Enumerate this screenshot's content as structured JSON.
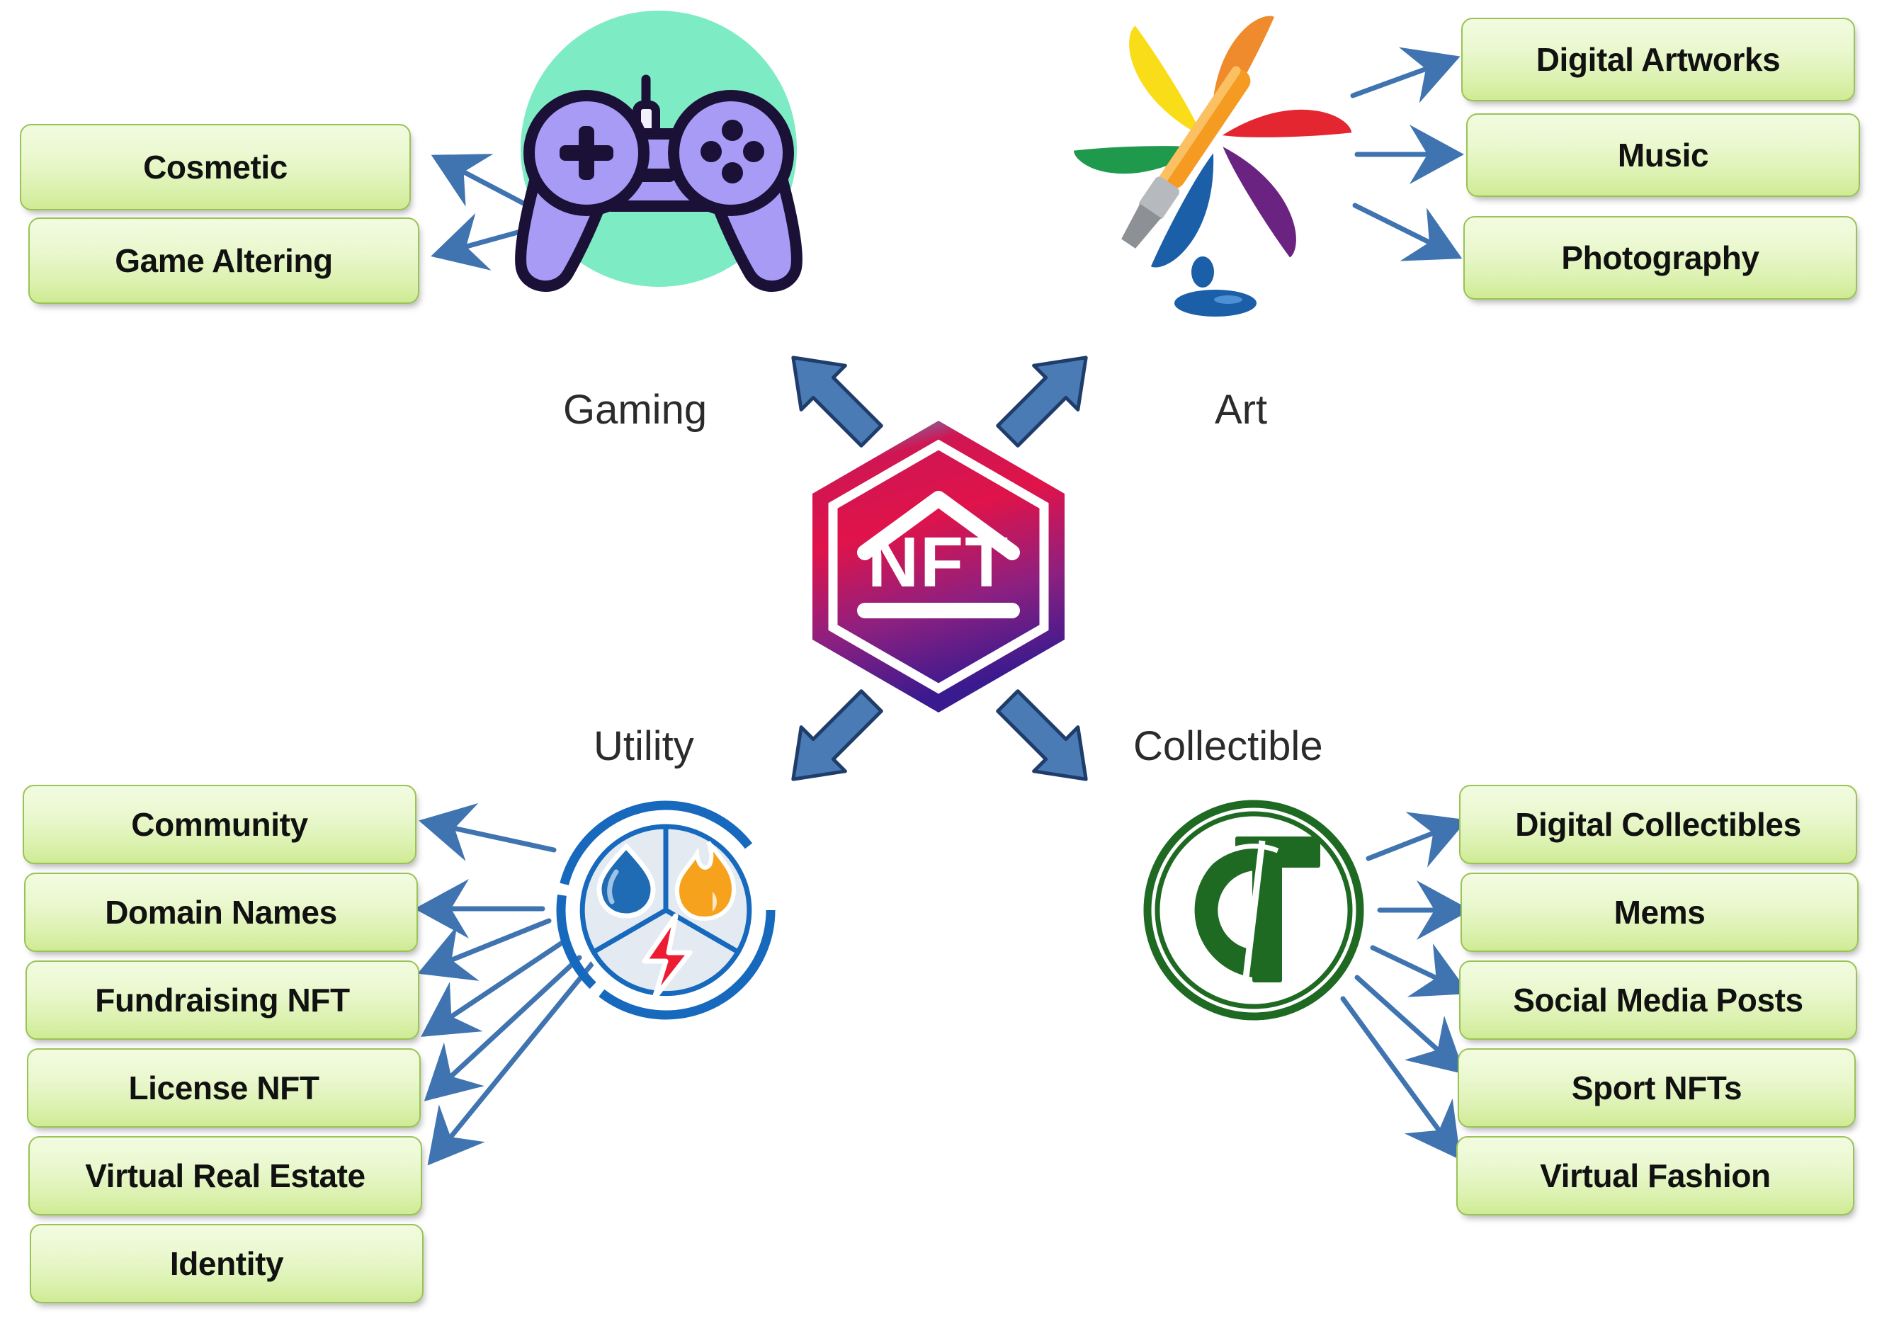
{
  "diagram": {
    "center": {
      "label": "NFT",
      "gradient_top": "#31b7e8",
      "gradient_mid": "#e0134a",
      "gradient_bottom": "#3a1a8f"
    },
    "box_style": {
      "fill_top": "#f2fbe0",
      "fill_bottom": "#cfeb94",
      "border": "#9ac356",
      "text": "#111111"
    },
    "arrow_color": "#4a7bb5",
    "arrow_outline": "#1f3d6b",
    "branches": [
      {
        "id": "gaming",
        "caption": "Gaming",
        "icon": "game-controller-icon",
        "icon_colors": {
          "background": "#7debc4",
          "body": "#a79bf6",
          "outline": "#1b1036"
        },
        "items": [
          "Cosmetic",
          "Game Altering"
        ]
      },
      {
        "id": "art",
        "caption": "Art",
        "icon": "art-palette-brush-icon",
        "icon_colors": {
          "yellow": "#f9dd18",
          "orange": "#ef8b2c",
          "red": "#e32630",
          "purple": "#6b2382",
          "blue": "#1b5fa8",
          "green": "#1f9a4d",
          "brush": "#f59b22"
        },
        "items": [
          "Digital Artworks",
          "Music",
          "Photography"
        ]
      },
      {
        "id": "utility",
        "caption": "Utility",
        "icon": "utility-pie-icon",
        "icon_colors": {
          "ring": "#1769bd",
          "sector_fill": "#e4eaf2",
          "water_drop": "#1f6cb4",
          "flame": "#f6a21d",
          "bolt": "#ec1c33"
        },
        "items": [
          "Community",
          "Domain Names",
          "Fundraising NFT",
          "License NFT",
          "Virtual Real Estate",
          "Identity"
        ]
      },
      {
        "id": "collectible",
        "caption": "Collectible",
        "icon": "collectible-coin-monogram-icon",
        "icon_colors": {
          "green": "#1f6a23"
        },
        "items": [
          "Digital Collectibles",
          "Mems",
          "Social Media Posts",
          "Sport NFTs",
          "Virtual Fashion"
        ]
      }
    ]
  }
}
